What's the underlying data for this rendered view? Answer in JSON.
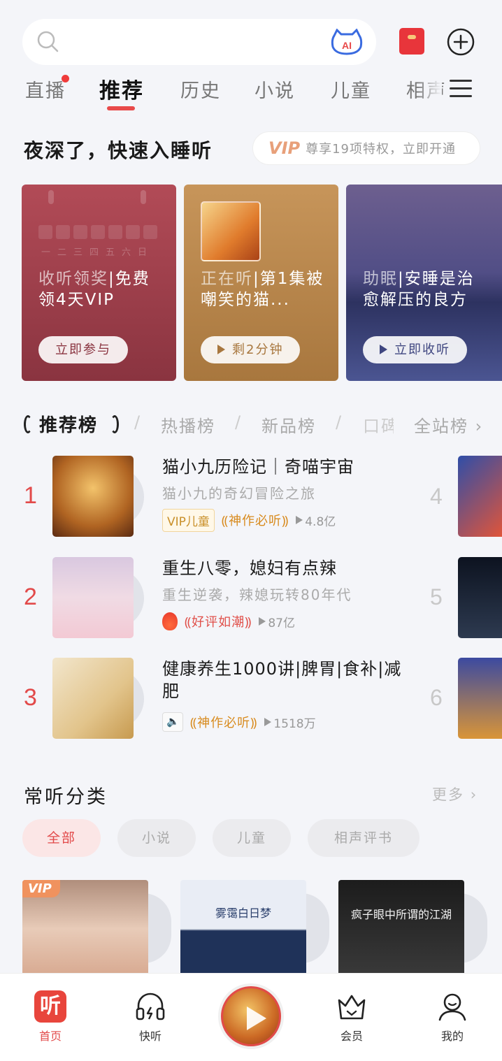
{
  "search": {
    "ai_label": "AI"
  },
  "tabs": [
    {
      "label": "直播",
      "active": false,
      "dot": true
    },
    {
      "label": "推荐",
      "active": true
    },
    {
      "label": "历史",
      "active": false
    },
    {
      "label": "小说",
      "active": false
    },
    {
      "label": "儿童",
      "active": false
    },
    {
      "label": "相声",
      "active": false
    }
  ],
  "greeting": "夜深了，快速入睡听",
  "vip_pill": {
    "badge": "VIP",
    "text": "尊享19项特权，立即开通"
  },
  "promo_cards": [
    {
      "title_dim": "收听领奖",
      "title": "|免费领4天VIP",
      "button": "立即参与",
      "calendar_days": "一二三四五六日"
    },
    {
      "title_dim": "正在听",
      "title": "|第1集被嘲笑的猫...",
      "button": "剩2分钟"
    },
    {
      "title_dim": "助眠",
      "title": "|安睡是治愈解压的良方",
      "button": "立即收听"
    }
  ],
  "rank_tabs": [
    {
      "label": "推荐榜",
      "active": true
    },
    {
      "label": "热播榜"
    },
    {
      "label": "新品榜"
    },
    {
      "label": "口碑"
    },
    {
      "label": "全站榜",
      "chevron": true
    }
  ],
  "rank_items": [
    {
      "num": "1",
      "title": "猫小九历险记｜奇喵宇宙",
      "sub": "猫小九的奇幻冒险之旅",
      "tag": "VIP儿童",
      "award": "神作必听",
      "plays": "4.8亿"
    },
    {
      "num": "2",
      "title": "重生八零，媳妇有点辣",
      "sub": "重生逆袭，辣媳玩转80年代",
      "award": "好评如潮",
      "plays": "87亿"
    },
    {
      "num": "3",
      "title": "健康养生1000讲|脾胃|食补|减肥",
      "award": "神作必听",
      "plays": "1518万"
    }
  ],
  "side_nums": [
    "4",
    "5",
    "6"
  ],
  "categories": {
    "title": "常听分类",
    "more": "更多",
    "chips": [
      {
        "label": "全部",
        "active": true
      },
      {
        "label": "小说"
      },
      {
        "label": "儿童"
      },
      {
        "label": "相声评书"
      }
    ],
    "cards": [
      {
        "badge": "VIP"
      },
      {
        "caption": "雾霭白日梦"
      },
      {
        "caption": "疯子眼中所谓的江湖"
      }
    ]
  },
  "bottom_nav": [
    {
      "label": "首页",
      "active": true,
      "icon_char": "听"
    },
    {
      "label": "快听"
    },
    {
      "label": "会员"
    },
    {
      "label": "我的"
    }
  ],
  "colors": {
    "accent": "#e24a4a",
    "background": "#f4f5f9"
  }
}
